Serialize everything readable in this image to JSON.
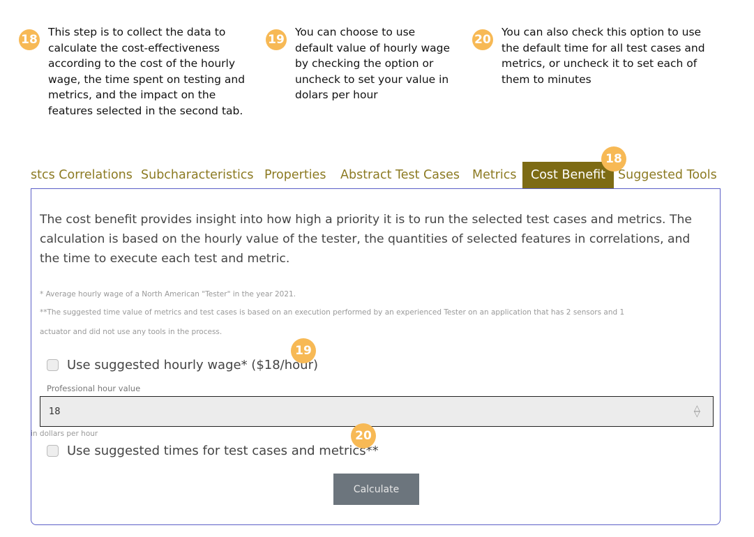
{
  "callouts": [
    {
      "number": "18",
      "text": "This step is to collect the data to\ncalculate the cost-effectiveness\naccording to the cost of the hourly\nwage, the time spent on testing and\nmetrics, and the impact on the\nfeatures selected in the second tab."
    },
    {
      "number": "19",
      "text": "You can choose to use\ndefault value of hourly wage\nby checking the option or\nuncheck to set your value in\ndolars per hour"
    },
    {
      "number": "20",
      "text": "You can also check this option to use\nthe default time for all test cases and\nmetrics, or uncheck it to set each of\nthem to minutes"
    }
  ],
  "tabs": [
    {
      "label": "stcs Correlations"
    },
    {
      "label": "Subcharacteristics"
    },
    {
      "label": "Properties"
    },
    {
      "label": "Abstract Test Cases"
    },
    {
      "label": "Metrics"
    },
    {
      "label": "Cost Benefit",
      "active": true
    },
    {
      "label": "Suggested Tools"
    }
  ],
  "tab_badge": "18",
  "panel": {
    "description": "The cost benefit provides insight into how high a priority it is to run the selected test cases and metrics. The calculation is based on the hourly value of the tester, the quantities of selected features in correlations, and the time to execute each test and metric.",
    "footnote1": "* Average hourly wage of a North American \"Tester\" in the year 2021.",
    "footnote2": "**The suggested time value of metrics and test cases is based on an execution performed by an experienced Tester on an application that has 2 sensors and 1",
    "footnote3": "actuator and did not use any tools in the process.",
    "wage_checkbox_label": "Use suggested hourly wage* ($18/hour)",
    "wage_checked": false,
    "wage_badge": "19",
    "hour_field_label": "Professional hour value",
    "hour_value": "18",
    "hour_help": "in dollars per hour",
    "times_checkbox_label": "Use suggested times for test cases and metrics**",
    "times_checked": false,
    "times_badge": "20",
    "calculate_label": "Calculate"
  },
  "colors": {
    "badge": "#f7b955",
    "tab_text": "#8c7a22",
    "tab_active_bg": "#7d6b14",
    "panel_border": "#5b5fc7",
    "button_bg": "#6c757d"
  }
}
